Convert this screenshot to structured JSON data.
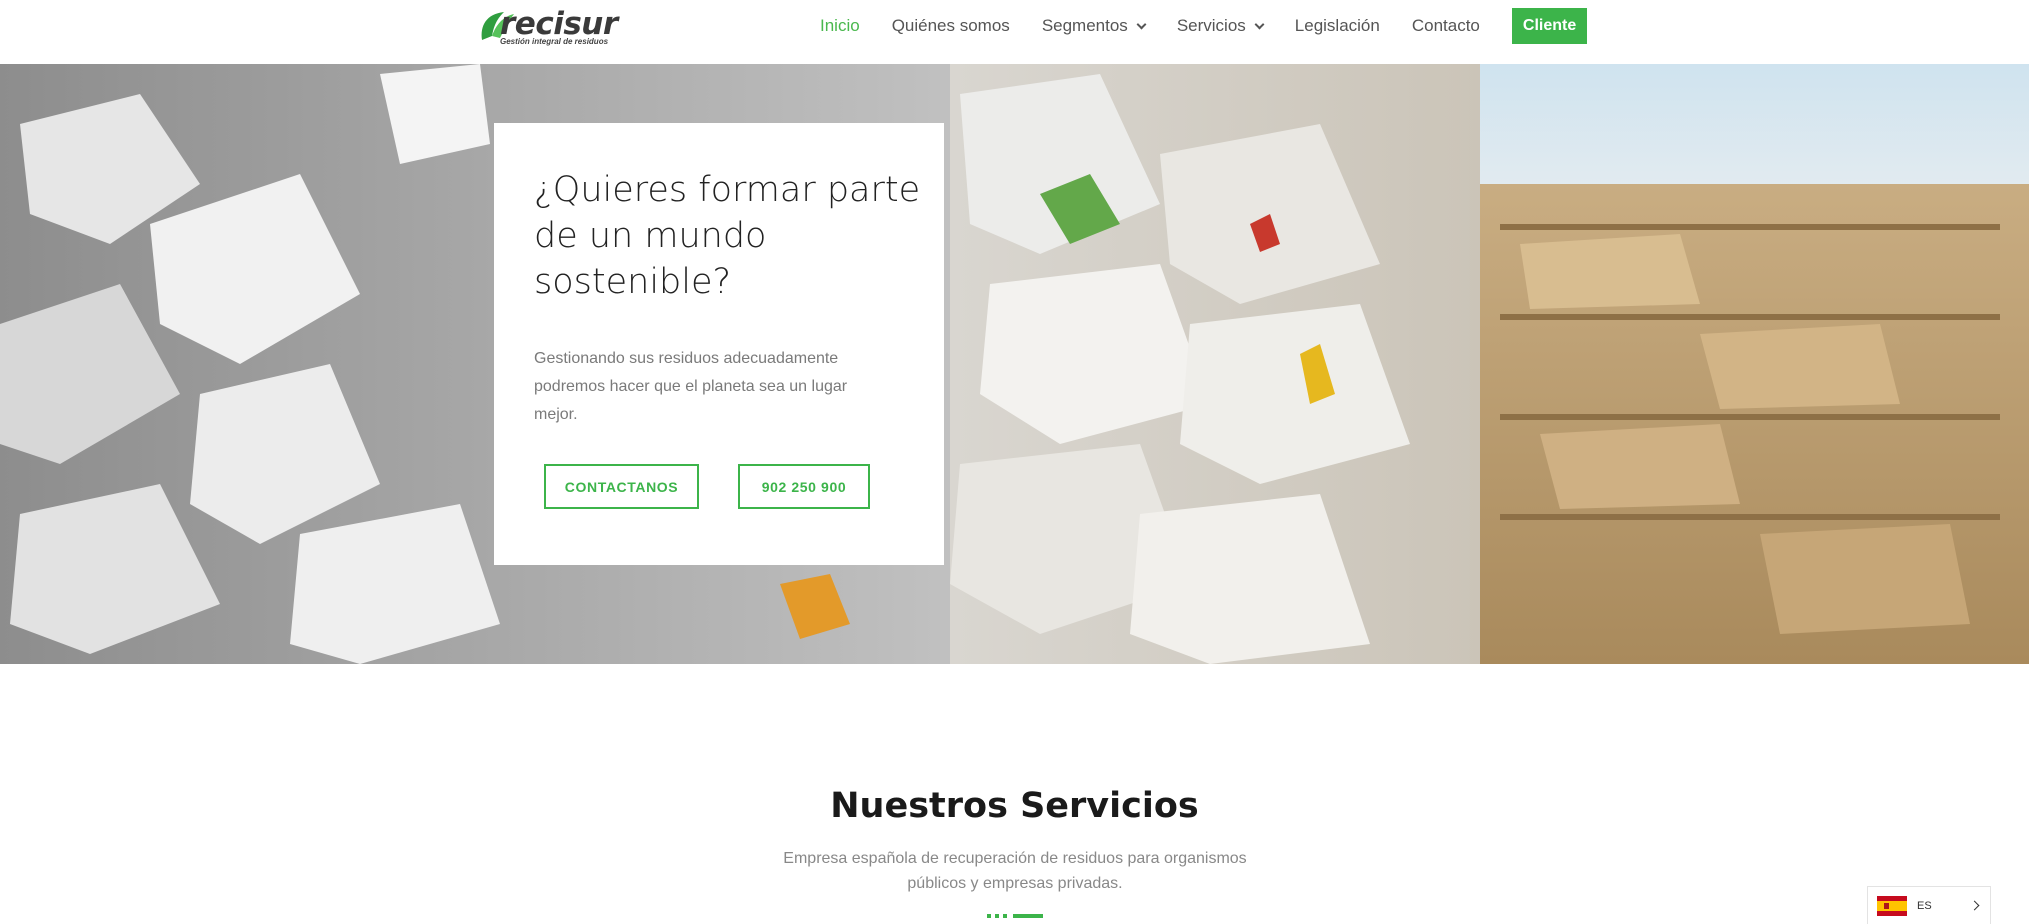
{
  "header": {
    "logo_text": "recisur",
    "logo_tagline": "Gestión integral de residuos",
    "nav": [
      {
        "label": "Inicio",
        "active": true
      },
      {
        "label": "Quiénes somos"
      },
      {
        "label": "Segmentos",
        "dropdown": true
      },
      {
        "label": "Servicios",
        "dropdown": true
      },
      {
        "label": "Legislación"
      },
      {
        "label": "Contacto"
      }
    ],
    "cliente_label": "Cliente"
  },
  "hero": {
    "title": "¿Quieres formar parte de un mundo sostenible?",
    "text": "Gestionando sus residuos adecuadamente podremos hacer que el planeta sea un lugar mejor.",
    "contact_button": "CONTACTANOS",
    "phone_button": "902 250 900",
    "background": "bales-of-recycled-paper-photo"
  },
  "services": {
    "title": "Nuestros Servicios",
    "subtitle": "Empresa española de recuperación de residuos para organismos públicos y empresas privadas."
  },
  "language": {
    "code": "ES",
    "flag": "spain-flag-icon"
  },
  "colors": {
    "accent": "#3cb44a",
    "nav_text": "#555555",
    "nav_active": "#4ab84e"
  }
}
